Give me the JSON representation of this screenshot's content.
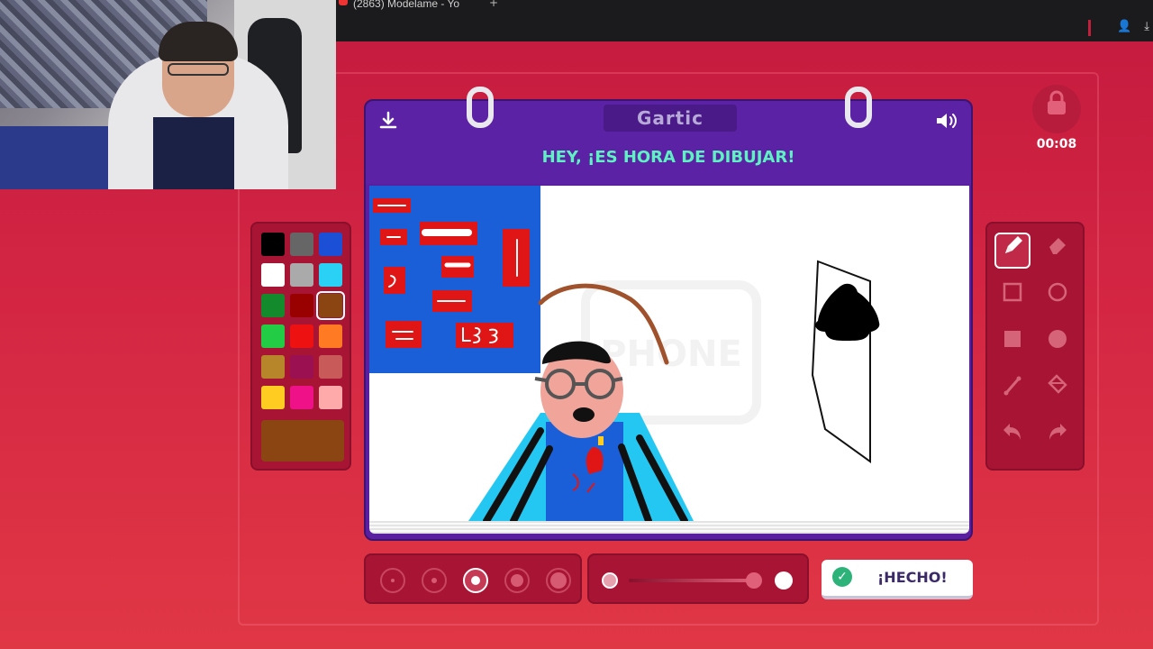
{
  "browser": {
    "tab_title": "(2863) Modelame - Yo",
    "icons": [
      "person-icon",
      "download-icon"
    ]
  },
  "game": {
    "logo": "Gartic",
    "prompt": "HEY, ¡ES HORA DE DIBUJAR!",
    "timer": "00:08",
    "done_label": "¡HECHO!",
    "canvas_watermark": "Gartic PHONE"
  },
  "palette": {
    "colors": [
      "#000000",
      "#666666",
      "#1a4fd6",
      "#ffffff",
      "#aaaaaa",
      "#2ad1f5",
      "#138a2b",
      "#990000",
      "#8b4513",
      "#22cc44",
      "#ee1111",
      "#ff7a22",
      "#b8862a",
      "#9a1050",
      "#c85a5a",
      "#ffcc22",
      "#ee1188",
      "#ffaaaa"
    ],
    "selected_index": 8,
    "current_color": "#8b4513"
  },
  "tools": [
    "pencil-icon",
    "eraser-icon",
    "rect-outline-icon",
    "circle-outline-icon",
    "rect-filled-icon",
    "circle-filled-icon",
    "line-icon",
    "fill-bucket-icon",
    "undo-icon",
    "redo-icon"
  ],
  "brush_sizes": {
    "count": 5,
    "selected_index": 2
  },
  "opacity": {
    "selected": "full"
  }
}
